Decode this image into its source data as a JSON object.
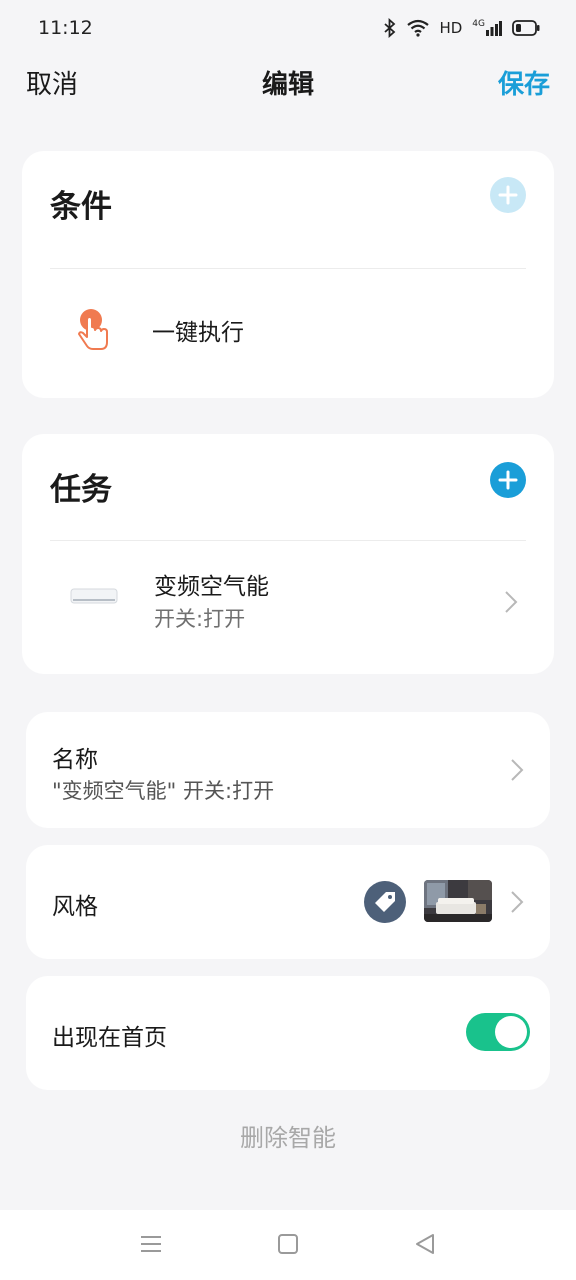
{
  "status_bar": {
    "time": "11:12",
    "hd_label": "HD",
    "network_label": "4G",
    "icons": [
      "bluetooth-icon",
      "wifi-icon",
      "signal-icon",
      "battery-icon"
    ]
  },
  "header": {
    "cancel_label": "取消",
    "title": "编辑",
    "save_label": "保存"
  },
  "conditions": {
    "title": "条件",
    "items": [
      {
        "label": "一键执行",
        "icon": "tap-hand-icon"
      }
    ]
  },
  "tasks": {
    "title": "任务",
    "items": [
      {
        "label": "变频空气能",
        "sub": "开关:打开",
        "icon": "air-conditioner-icon"
      }
    ]
  },
  "name_row": {
    "label": "名称",
    "value": "\"变频空气能\" 开关:打开"
  },
  "style_row": {
    "label": "风格"
  },
  "home_row": {
    "label": "出现在首页",
    "toggle_on": true
  },
  "delete_label": "删除智能",
  "colors": {
    "accent": "#1a9ed8",
    "plus_active": "#1a9ed8",
    "plus_disabled": "#c8e8f6",
    "toggle_on": "#19c28c",
    "tap_icon": "#f07a50",
    "tag_icon_bg": "#4d6079"
  }
}
